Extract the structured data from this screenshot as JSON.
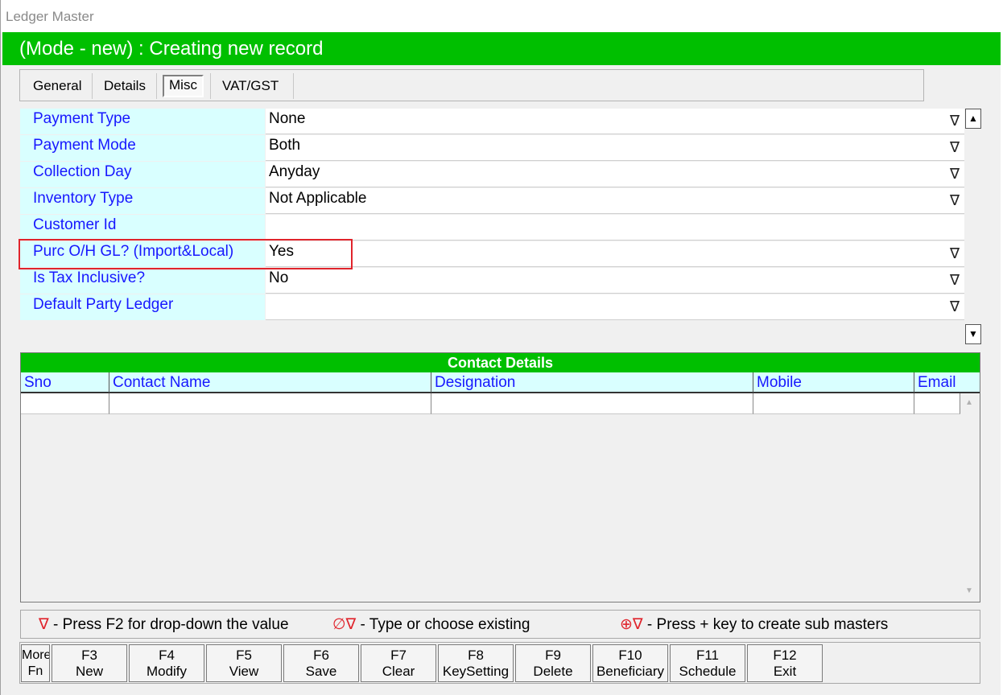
{
  "window": {
    "title": "Ledger Master"
  },
  "mode_text": "(Mode - new) : Creating new record",
  "tabs": [
    {
      "label": "General"
    },
    {
      "label": "Details"
    },
    {
      "label": "Misc"
    },
    {
      "label": "VAT/GST"
    }
  ],
  "active_tab": "Misc",
  "fields": [
    {
      "label": "Payment Type",
      "value": "None",
      "dropdown": true
    },
    {
      "label": "Payment Mode",
      "value": "Both",
      "dropdown": true
    },
    {
      "label": "Collection Day",
      "value": "Anyday",
      "dropdown": true
    },
    {
      "label": "Inventory Type",
      "value": "Not Applicable",
      "dropdown": true
    },
    {
      "label": "Customer Id",
      "value": "",
      "dropdown": false
    },
    {
      "label": "Purc O/H GL? (Import&Local)",
      "value": "Yes",
      "dropdown": true
    },
    {
      "label": "Is Tax Inclusive?",
      "value": "No",
      "dropdown": true
    },
    {
      "label": "Default Party Ledger",
      "value": "",
      "dropdown": true
    }
  ],
  "dropdown_glyph": "∇",
  "contact": {
    "title": "Contact Details",
    "columns": [
      "Sno",
      "Contact Name",
      "Designation",
      "Mobile",
      "Email"
    ]
  },
  "legend": {
    "f2_symbol": "∇",
    "f2_text": " - Press F2 for drop-down the value",
    "type_symbol": "∅∇",
    "type_text": " - Type or choose existing",
    "plus_symbol": "⊕∇",
    "plus_text": " - Press + key to create sub masters"
  },
  "function_keys": [
    {
      "key": "More",
      "label": "Fn"
    },
    {
      "key": "F3",
      "label": "New"
    },
    {
      "key": "F4",
      "label": "Modify"
    },
    {
      "key": "F5",
      "label": "View"
    },
    {
      "key": "F6",
      "label": "Save"
    },
    {
      "key": "F7",
      "label": "Clear"
    },
    {
      "key": "F8",
      "label": "KeySetting"
    },
    {
      "key": "F9",
      "label": "Delete"
    },
    {
      "key": "F10",
      "label": "Beneficiary"
    },
    {
      "key": "F11",
      "label": "Schedule"
    },
    {
      "key": "F12",
      "label": "Exit"
    }
  ],
  "colors": {
    "accent_green": "#00bf00",
    "label_bg": "#d9ffff",
    "label_text": "#1717ff",
    "highlight_red": "#e0242c"
  }
}
